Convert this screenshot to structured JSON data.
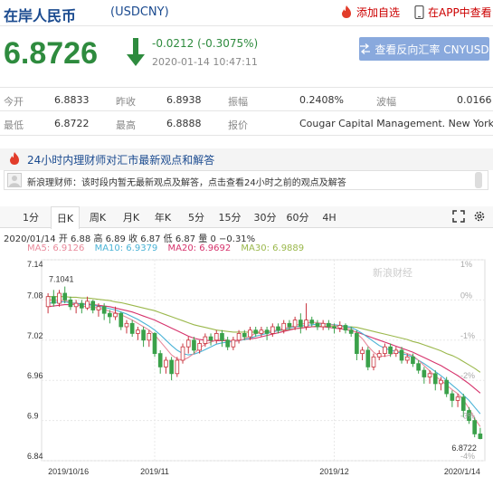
{
  "header": {
    "title": "在岸人民币",
    "code": "(USDCNY)",
    "add_favorite": "添加自选",
    "app_view": "在APP中查看"
  },
  "quote": {
    "price": "6.8726",
    "change": "-0.0212 (-0.3075%)",
    "timestamp": "2020-01-14  10:47:11",
    "reverse_button": "查看反向汇率 CNYUSD"
  },
  "stats": {
    "row1": [
      {
        "label": "今开",
        "value": "6.8833"
      },
      {
        "label": "昨收",
        "value": "6.8938"
      },
      {
        "label": "振幅",
        "value": "0.2408%"
      },
      {
        "label": "波幅",
        "value": "0.0166"
      }
    ],
    "row2": [
      {
        "label": "最低",
        "value": "6.8722"
      },
      {
        "label": "最高",
        "value": "6.8888"
      },
      {
        "label": "报价",
        "value": "Cougar Capital Management. New York"
      }
    ]
  },
  "news": {
    "title": "24小时内理财师对汇市最新观点和解答",
    "message": "新浪理财师：该时段内暂无最新观点及解答，点击查看24小时之前的观点及解答"
  },
  "tabs": [
    "1分",
    "日K",
    "周K",
    "月K",
    "年K",
    "5分",
    "15分",
    "30分",
    "60分",
    "4H"
  ],
  "active_tab": "日K",
  "candle_info": {
    "text": "2020/01/14  开 6.88  高 6.89  收 6.87  低 6.87  量 0  −0.31%"
  },
  "ma": {
    "ma5": "MA5: 6.9126",
    "ma10": "MA10: 6.9379",
    "ma20": "MA20: 6.9692",
    "ma30": "MA30: 6.9889"
  },
  "colors": {
    "up": "#c8323c",
    "down": "#3aa14a",
    "ma5": "#e98a9b",
    "ma10": "#4ab3d6",
    "ma20": "#d6336c",
    "ma30": "#9bb84c"
  },
  "chart_data": {
    "type": "candlestick",
    "y_ticks": [
      "7.14",
      "7.08",
      "7.02",
      "6.96",
      "6.9",
      "6.84"
    ],
    "pct_ticks": [
      "1%",
      "0%",
      "-1%",
      "-2%",
      "-3%",
      "-4%"
    ],
    "x_labels": [
      "2019/10/16",
      "2019/11",
      "2019/12",
      "2020/1/14"
    ],
    "ylim": [
      6.84,
      7.14
    ],
    "max_label": "7.1041",
    "min_label": "6.8722",
    "watermark": "新浪财经",
    "candles": [
      [
        7.07,
        7.085,
        7.09,
        7.06
      ],
      [
        7.085,
        7.075,
        7.095,
        7.07
      ],
      [
        7.075,
        7.09,
        7.095,
        7.07
      ],
      [
        7.09,
        7.08,
        7.1,
        7.075
      ],
      [
        7.08,
        7.07,
        7.085,
        7.065
      ],
      [
        7.07,
        7.075,
        7.08,
        7.06
      ],
      [
        7.075,
        7.068,
        7.08,
        7.06
      ],
      [
        7.068,
        7.078,
        7.085,
        7.065
      ],
      [
        7.078,
        7.065,
        7.08,
        7.06
      ],
      [
        7.065,
        7.07,
        7.075,
        7.055
      ],
      [
        7.07,
        7.06,
        7.075,
        7.05
      ],
      [
        7.06,
        7.055,
        7.065,
        7.045
      ],
      [
        7.055,
        7.06,
        7.07,
        7.05
      ],
      [
        7.06,
        7.04,
        7.062,
        7.035
      ],
      [
        7.04,
        7.045,
        7.05,
        7.03
      ],
      [
        7.045,
        7.03,
        7.05,
        7.025
      ],
      [
        7.03,
        7.035,
        7.04,
        7.02
      ],
      [
        7.035,
        7.02,
        7.04,
        7.01
      ],
      [
        7.02,
        7.03,
        7.035,
        7.01
      ],
      [
        7.03,
        7.0,
        7.032,
        6.995
      ],
      [
        7.0,
        6.98,
        7.005,
        6.97
      ],
      [
        6.98,
        6.99,
        6.995,
        6.97
      ],
      [
        6.99,
        6.97,
        6.995,
        6.96
      ],
      [
        6.97,
        6.99,
        6.995,
        6.965
      ],
      [
        6.99,
        7.01,
        7.015,
        6.985
      ],
      [
        7.01,
        7.02,
        7.025,
        7.0
      ],
      [
        7.02,
        7.005,
        7.025,
        7.0
      ],
      [
        7.005,
        7.015,
        7.02,
        7.0
      ],
      [
        7.015,
        7.025,
        7.03,
        7.01
      ],
      [
        7.025,
        7.02,
        7.03,
        7.012
      ],
      [
        7.02,
        7.03,
        7.035,
        7.015
      ],
      [
        7.03,
        7.02,
        7.035,
        7.01
      ],
      [
        7.02,
        7.01,
        7.025,
        7.005
      ],
      [
        7.01,
        7.02,
        7.025,
        7.005
      ],
      [
        7.02,
        7.03,
        7.035,
        7.015
      ],
      [
        7.03,
        7.025,
        7.035,
        7.02
      ],
      [
        7.025,
        7.035,
        7.04,
        7.02
      ],
      [
        7.035,
        7.03,
        7.04,
        7.025
      ],
      [
        7.03,
        7.035,
        7.04,
        7.025
      ],
      [
        7.035,
        7.03,
        7.04,
        7.02
      ],
      [
        7.03,
        7.04,
        7.045,
        7.025
      ],
      [
        7.04,
        7.035,
        7.045,
        7.03
      ],
      [
        7.035,
        7.045,
        7.05,
        7.03
      ],
      [
        7.045,
        7.04,
        7.05,
        7.035
      ],
      [
        7.04,
        7.05,
        7.055,
        7.035
      ],
      [
        7.05,
        7.04,
        7.06,
        7.03
      ],
      [
        7.04,
        7.05,
        7.075,
        7.035
      ],
      [
        7.05,
        7.045,
        7.055,
        7.04
      ],
      [
        7.045,
        7.04,
        7.05,
        7.035
      ],
      [
        7.04,
        7.045,
        7.05,
        7.035
      ],
      [
        7.045,
        7.04,
        7.05,
        7.035
      ],
      [
        7.04,
        7.038,
        7.045,
        7.03
      ],
      [
        7.038,
        7.042,
        7.048,
        7.032
      ],
      [
        7.042,
        7.035,
        7.045,
        7.03
      ],
      [
        7.035,
        7.03,
        7.04,
        7.025
      ],
      [
        7.03,
        7.0,
        7.035,
        6.99
      ],
      [
        7.0,
        7.005,
        7.01,
        6.99
      ],
      [
        7.005,
        6.98,
        7.01,
        6.975
      ],
      [
        6.98,
        6.995,
        7.0,
        6.975
      ],
      [
        6.995,
        7.0,
        7.005,
        6.99
      ],
      [
        7.0,
        7.01,
        7.015,
        6.995
      ],
      [
        7.01,
        7.0,
        7.015,
        6.995
      ],
      [
        7.0,
        7.005,
        7.01,
        6.995
      ],
      [
        7.005,
        6.99,
        7.01,
        6.985
      ],
      [
        6.99,
        6.995,
        7.0,
        6.985
      ],
      [
        6.995,
        6.985,
        7.0,
        6.98
      ],
      [
        6.985,
        6.975,
        6.99,
        6.97
      ],
      [
        6.975,
        6.965,
        6.98,
        6.955
      ],
      [
        6.965,
        6.97,
        6.975,
        6.955
      ],
      [
        6.97,
        6.955,
        6.975,
        6.945
      ],
      [
        6.955,
        6.96,
        6.965,
        6.945
      ],
      [
        6.96,
        6.94,
        6.965,
        6.935
      ],
      [
        6.94,
        6.93,
        6.945,
        6.92
      ],
      [
        6.93,
        6.935,
        6.94,
        6.92
      ],
      [
        6.935,
        6.915,
        6.94,
        6.905
      ],
      [
        6.915,
        6.9,
        6.92,
        6.895
      ],
      [
        6.9,
        6.88,
        6.905,
        6.875
      ],
      [
        6.88,
        6.873,
        6.889,
        6.872
      ]
    ],
    "ma5": [
      7.08,
      7.08,
      7.079,
      7.079,
      7.077,
      7.073,
      7.071,
      7.07,
      7.069,
      7.068,
      7.066,
      7.063,
      7.061,
      7.058,
      7.054,
      7.05,
      7.045,
      7.04,
      7.035,
      7.028,
      7.018,
      7.008,
      6.998,
      6.992,
      6.99,
      6.994,
      7.0,
      7.008,
      7.014,
      7.017,
      7.02,
      7.022,
      7.02,
      7.018,
      7.019,
      7.022,
      7.026,
      7.03,
      7.031,
      7.033,
      7.034,
      7.035,
      7.038,
      7.039,
      7.042,
      7.044,
      7.045,
      7.047,
      7.046,
      7.045,
      7.044,
      7.042,
      7.04,
      7.039,
      7.037,
      7.03,
      7.022,
      7.011,
      7.002,
      6.996,
      6.996,
      6.998,
      7.003,
      7.003,
      7.0,
      6.997,
      6.99,
      6.982,
      6.974,
      6.966,
      6.96,
      6.953,
      6.946,
      6.94,
      6.931,
      6.918,
      6.903,
      6.891
    ],
    "ma10": [
      7.075,
      7.076,
      7.077,
      7.077,
      7.076,
      7.075,
      7.074,
      7.073,
      7.072,
      7.071,
      7.069,
      7.067,
      7.065,
      7.062,
      7.059,
      7.055,
      7.051,
      7.046,
      7.041,
      7.035,
      7.028,
      7.02,
      7.012,
      7.005,
      7.0,
      6.998,
      6.999,
      7.002,
      7.006,
      7.01,
      7.014,
      7.016,
      7.017,
      7.018,
      7.019,
      7.021,
      7.023,
      7.026,
      7.028,
      7.03,
      7.032,
      7.034,
      7.036,
      7.038,
      7.04,
      7.041,
      7.042,
      7.043,
      7.044,
      7.044,
      7.044,
      7.043,
      7.042,
      7.041,
      7.039,
      7.035,
      7.03,
      7.024,
      7.018,
      7.012,
      7.008,
      7.005,
      7.003,
      7.0,
      6.998,
      6.995,
      6.99,
      6.985,
      6.979,
      6.973,
      6.967,
      6.96,
      6.953,
      6.946,
      6.938,
      6.93,
      6.92,
      6.91
    ],
    "ma20": [
      7.07,
      7.071,
      7.072,
      7.073,
      7.073,
      7.074,
      7.074,
      7.074,
      7.073,
      7.072,
      7.071,
      7.07,
      7.068,
      7.066,
      7.064,
      7.062,
      7.059,
      7.056,
      7.053,
      7.05,
      7.046,
      7.042,
      7.038,
      7.034,
      7.03,
      7.026,
      7.023,
      7.021,
      7.02,
      7.019,
      7.019,
      7.019,
      7.019,
      7.019,
      7.02,
      7.021,
      7.022,
      7.023,
      7.025,
      7.027,
      7.029,
      7.031,
      7.033,
      7.035,
      7.037,
      7.038,
      7.039,
      7.04,
      7.04,
      7.04,
      7.039,
      7.038,
      7.037,
      7.036,
      7.034,
      7.032,
      7.029,
      7.026,
      7.023,
      7.02,
      7.017,
      7.014,
      7.011,
      7.008,
      7.005,
      7.002,
      6.998,
      6.994,
      6.99,
      6.986,
      6.982,
      6.977,
      6.972,
      6.967,
      6.961,
      6.955,
      6.948,
      6.941
    ],
    "ma30": [
      7.085,
      7.085,
      7.085,
      7.085,
      7.084,
      7.084,
      7.083,
      7.083,
      7.082,
      7.081,
      7.08,
      7.079,
      7.077,
      7.076,
      7.074,
      7.072,
      7.07,
      7.068,
      7.066,
      7.064,
      7.061,
      7.058,
      7.055,
      7.052,
      7.049,
      7.046,
      7.043,
      7.041,
      7.039,
      7.037,
      7.035,
      7.034,
      7.033,
      7.032,
      7.032,
      7.032,
      7.032,
      7.032,
      7.032,
      7.033,
      7.033,
      7.034,
      7.035,
      7.036,
      7.037,
      7.038,
      7.039,
      7.04,
      7.041,
      7.041,
      7.041,
      7.041,
      7.041,
      7.04,
      7.04,
      7.039,
      7.037,
      7.035,
      7.033,
      7.031,
      7.029,
      7.027,
      7.025,
      7.023,
      7.021,
      7.018,
      7.016,
      7.013,
      7.01,
      7.007,
      7.004,
      7.0,
      6.997,
      6.993,
      6.988,
      6.983,
      6.978,
      6.972
    ]
  }
}
